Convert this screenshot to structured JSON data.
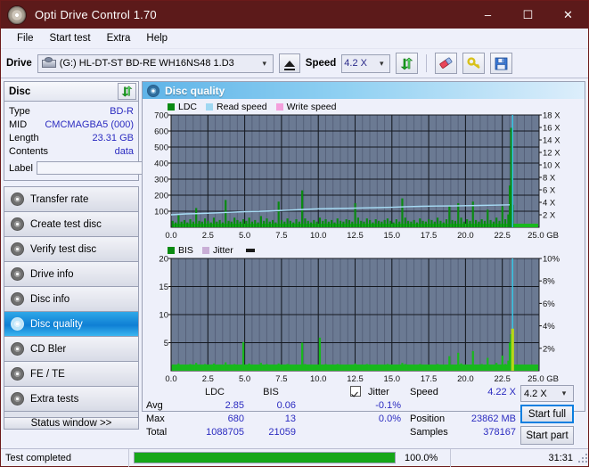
{
  "window": {
    "title": "Opti Drive Control 1.70",
    "icon": "disc-icon",
    "minimize": "–",
    "maximize": "☐",
    "close": "✕"
  },
  "menu": {
    "items": [
      "File",
      "Start test",
      "Extra",
      "Help"
    ]
  },
  "toolbar": {
    "drive_label": "Drive",
    "drive_value": "(G:)  HL-DT-ST BD-RE  WH16NS48 1.D3",
    "eject_icon": "eject-icon",
    "speed_label": "Speed",
    "speed_value": "4.2 X",
    "refresh_icon": "refresh-icon",
    "erase_icon": "eraser-icon",
    "key_icon": "key-icon",
    "save_icon": "save-icon"
  },
  "disc": {
    "title": "Disc",
    "refresh_icon": "refresh-icon",
    "rows": [
      {
        "label": "Type",
        "value": "BD-R"
      },
      {
        "label": "MID",
        "value": "CMCMAGBA5 (000)"
      },
      {
        "label": "Length",
        "value": "23.31 GB"
      },
      {
        "label": "Contents",
        "value": "data"
      }
    ],
    "label_field": {
      "label": "Label",
      "value": "",
      "placeholder": ""
    },
    "label_button_icon": "disc-label-icon"
  },
  "nav": {
    "items": [
      {
        "label": "Transfer rate",
        "icon": "disc-transfer-icon",
        "active": false
      },
      {
        "label": "Create test disc",
        "icon": "disc-create-icon",
        "active": false
      },
      {
        "label": "Verify test disc",
        "icon": "disc-verify-icon",
        "active": false
      },
      {
        "label": "Drive info",
        "icon": "disc-drive-icon",
        "active": false
      },
      {
        "label": "Disc info",
        "icon": "disc-info-icon",
        "active": false
      },
      {
        "label": "Disc quality",
        "icon": "disc-quality-icon",
        "active": true
      },
      {
        "label": "CD Bler",
        "icon": "disc-bler-icon",
        "active": false
      },
      {
        "label": "FE / TE",
        "icon": "disc-fete-icon",
        "active": false
      },
      {
        "label": "Extra tests",
        "icon": "disc-extra-icon",
        "active": false
      }
    ],
    "status_window_button": "Status window >>"
  },
  "main": {
    "header_title": "Disc quality",
    "header_icon": "disc-quality-icon"
  },
  "chart_data": [
    {
      "type": "line",
      "name": "ldc-chart",
      "title": "",
      "xlabel": "GB",
      "ylabel": "",
      "xlim": [
        0,
        25.0
      ],
      "ylim": [
        0,
        700
      ],
      "y2lim": [
        0,
        18
      ],
      "grid": true,
      "legend_position": "top-left",
      "legend": [
        {
          "label": "LDC",
          "color": "#0a8a12"
        },
        {
          "label": "Read speed",
          "color": "#9fd8f2"
        },
        {
          "label": "Write speed",
          "color": "#f49fdc"
        }
      ],
      "xticks": [
        "0.0",
        "2.5",
        "5.0",
        "7.5",
        "10.0",
        "12.5",
        "15.0",
        "17.5",
        "20.0",
        "22.5",
        "25.0 GB"
      ],
      "yticks": [
        "100",
        "200",
        "300",
        "400",
        "500",
        "600",
        "700"
      ],
      "y2ticks": [
        "2 X",
        "4 X",
        "6 X",
        "8 X",
        "10 X",
        "12 X",
        "14 X",
        "16 X",
        "18 X"
      ],
      "series": [
        {
          "name": "LDC",
          "color": "#0a8a12",
          "style": "bars",
          "x": [
            0.1,
            0.3,
            0.5,
            0.7,
            0.9,
            1.1,
            1.3,
            1.5,
            1.7,
            1.9,
            2.1,
            2.3,
            2.5,
            2.7,
            2.9,
            3.1,
            3.3,
            3.5,
            3.7,
            3.9,
            4.1,
            4.3,
            4.5,
            4.7,
            4.9,
            5.1,
            5.3,
            5.5,
            5.7,
            5.9,
            6.1,
            6.3,
            6.5,
            6.7,
            6.9,
            7.1,
            7.3,
            7.5,
            7.7,
            7.9,
            8.1,
            8.3,
            8.5,
            8.7,
            8.9,
            9.1,
            9.3,
            9.5,
            9.7,
            9.9,
            10.1,
            10.3,
            10.5,
            10.7,
            10.9,
            11.1,
            11.3,
            11.5,
            11.7,
            11.9,
            12.1,
            12.3,
            12.5,
            12.7,
            12.9,
            13.1,
            13.3,
            13.5,
            13.7,
            13.9,
            14.1,
            14.3,
            14.5,
            14.7,
            14.9,
            15.1,
            15.3,
            15.5,
            15.7,
            15.9,
            16.1,
            16.3,
            16.5,
            16.7,
            16.9,
            17.1,
            17.3,
            17.5,
            17.7,
            17.9,
            18.1,
            18.3,
            18.5,
            18.7,
            18.9,
            19.1,
            19.3,
            19.5,
            19.7,
            19.9,
            20.1,
            20.3,
            20.5,
            20.7,
            20.9,
            21.1,
            21.3,
            21.5,
            21.7,
            21.9,
            22.1,
            22.3,
            22.5,
            22.7,
            22.9,
            23.0,
            23.1,
            23.2
          ],
          "values": [
            40,
            30,
            75,
            35,
            45,
            30,
            50,
            35,
            120,
            40,
            35,
            55,
            40,
            30,
            60,
            35,
            45,
            30,
            170,
            40,
            35,
            60,
            45,
            35,
            50,
            40,
            60,
            35,
            45,
            30,
            70,
            40,
            55,
            35,
            45,
            30,
            160,
            45,
            35,
            55,
            40,
            30,
            50,
            35,
            230,
            55,
            40,
            30,
            45,
            35,
            60,
            40,
            50,
            35,
            45,
            30,
            55,
            40,
            35,
            50,
            45,
            35,
            150,
            60,
            40,
            35,
            55,
            45,
            30,
            50,
            40,
            35,
            45,
            55,
            40,
            30,
            50,
            35,
            180,
            60,
            40,
            35,
            45,
            30,
            55,
            40,
            35,
            50,
            45,
            35,
            60,
            40,
            30,
            50,
            130,
            45,
            40,
            150,
            60,
            35,
            50,
            40,
            160,
            45,
            35,
            50,
            40,
            110,
            45,
            35,
            60,
            40,
            130,
            50,
            80,
            260,
            620,
            140
          ]
        },
        {
          "name": "Read speed",
          "color": "#a7dcf5",
          "style": "line",
          "x": [
            0.0,
            1.0,
            2.0,
            3.0,
            4.0,
            5.0,
            6.0,
            7.0,
            8.0,
            9.0,
            10.0,
            11.0,
            12.0,
            13.0,
            14.0,
            15.0,
            16.0,
            17.0,
            18.0,
            19.0,
            20.0,
            21.0,
            22.0,
            23.0
          ],
          "values": [
            2.0,
            2.15,
            2.2,
            2.3,
            2.4,
            2.5,
            2.55,
            2.65,
            2.75,
            2.85,
            2.95,
            3.0,
            3.05,
            3.1,
            3.15,
            3.2,
            3.3,
            3.35,
            3.4,
            3.42,
            3.45,
            3.5,
            3.55,
            3.6
          ]
        },
        {
          "name": "Write speed",
          "color": "#f49fdc",
          "style": "line",
          "x": [],
          "values": []
        }
      ],
      "markers": [
        {
          "name": "end-of-disc-marker",
          "x": 23.2,
          "color": "#35c8e8"
        }
      ]
    },
    {
      "type": "line",
      "name": "bis-chart",
      "title": "",
      "xlabel": "GB",
      "ylabel": "",
      "xlim": [
        0,
        25.0
      ],
      "ylim": [
        0,
        20
      ],
      "y2lim": [
        0,
        10
      ],
      "grid": true,
      "legend_position": "top-left",
      "legend": [
        {
          "label": "BIS",
          "color": "#0a8a12"
        },
        {
          "label": "Jitter",
          "color": "#c9aed6"
        }
      ],
      "xticks": [
        "0.0",
        "2.5",
        "5.0",
        "7.5",
        "10.0",
        "12.5",
        "15.0",
        "17.5",
        "20.0",
        "22.5",
        "25.0 GB"
      ],
      "yticks": [
        "5",
        "10",
        "15",
        "20"
      ],
      "y2ticks": [
        "2%",
        "4%",
        "6%",
        "8%",
        "10%"
      ],
      "series": [
        {
          "name": "BIS",
          "color": "#18b81c",
          "style": "bars",
          "x": [
            0.1,
            0.3,
            0.5,
            0.7,
            0.9,
            1.1,
            1.3,
            1.5,
            1.7,
            1.9,
            2.1,
            2.3,
            2.5,
            2.7,
            2.9,
            3.1,
            3.3,
            3.5,
            3.7,
            3.9,
            4.1,
            4.3,
            4.5,
            4.7,
            4.9,
            5.1,
            5.3,
            5.5,
            5.7,
            5.9,
            6.1,
            6.3,
            6.5,
            6.7,
            6.9,
            7.1,
            7.3,
            7.5,
            7.7,
            7.9,
            8.1,
            8.3,
            8.5,
            8.7,
            8.9,
            9.1,
            9.3,
            9.5,
            9.7,
            9.9,
            10.1,
            10.3,
            10.5,
            10.7,
            10.9,
            11.1,
            11.3,
            11.5,
            11.7,
            11.9,
            12.1,
            12.3,
            12.5,
            12.7,
            12.9,
            13.1,
            13.3,
            13.5,
            13.7,
            13.9,
            14.1,
            14.3,
            14.5,
            14.7,
            14.9,
            15.1,
            15.3,
            15.5,
            15.7,
            15.9,
            16.1,
            16.3,
            16.5,
            16.7,
            16.9,
            17.1,
            17.3,
            17.5,
            17.7,
            17.9,
            18.1,
            18.3,
            18.5,
            18.7,
            18.9,
            19.1,
            19.3,
            19.5,
            19.7,
            19.9,
            20.1,
            20.3,
            20.5,
            20.7,
            20.9,
            21.1,
            21.3,
            21.5,
            21.7,
            21.9,
            22.1,
            22.3,
            22.5,
            22.7,
            22.9,
            23.0,
            23.1,
            23.2
          ],
          "values": [
            1.0,
            0.8,
            1.3,
            0.9,
            1.1,
            0.8,
            1.2,
            0.9,
            1.4,
            1.0,
            0.8,
            1.2,
            1.0,
            0.8,
            1.3,
            0.9,
            1.1,
            0.8,
            1.5,
            1.0,
            0.9,
            1.2,
            1.0,
            0.9,
            5.1,
            1.1,
            1.3,
            0.9,
            1.1,
            0.8,
            1.4,
            1.0,
            1.2,
            0.9,
            1.1,
            0.8,
            1.3,
            1.0,
            0.9,
            1.2,
            1.0,
            0.8,
            1.1,
            0.9,
            5.0,
            1.2,
            1.0,
            0.8,
            1.1,
            0.9,
            5.9,
            1.1,
            1.2,
            0.9,
            1.1,
            0.8,
            1.2,
            1.0,
            0.9,
            1.1,
            1.0,
            0.9,
            1.3,
            1.1,
            1.0,
            0.9,
            1.2,
            1.0,
            0.8,
            1.1,
            0.9,
            0.8,
            1.0,
            1.2,
            0.9,
            0.8,
            1.1,
            0.9,
            1.4,
            1.2,
            1.0,
            0.9,
            1.1,
            0.8,
            1.2,
            1.0,
            0.9,
            1.1,
            1.0,
            0.9,
            1.2,
            1.0,
            0.8,
            1.1,
            2.6,
            1.0,
            0.9,
            3.2,
            1.3,
            0.9,
            1.1,
            1.0,
            3.5,
            1.1,
            0.9,
            1.2,
            1.0,
            2.3,
            1.1,
            0.9,
            1.4,
            1.0,
            2.7,
            1.2,
            1.8,
            5.0,
            6.5,
            3.0
          ]
        },
        {
          "name": "Jitter",
          "color": "#c9aed6",
          "style": "line",
          "x": [],
          "values": []
        }
      ],
      "markers": [
        {
          "name": "end-of-disc-marker",
          "x": 23.2,
          "color": "#35c8e8"
        }
      ]
    }
  ],
  "stats": {
    "col_headers": [
      "",
      "LDC",
      "BIS"
    ],
    "rows": [
      {
        "label": "Avg",
        "ldc": "2.85",
        "bis": "0.06",
        "jitter": "-0.1%"
      },
      {
        "label": "Max",
        "ldc": "680",
        "bis": "13",
        "jitter": "0.0%"
      },
      {
        "label": "Total",
        "ldc": "1088705",
        "bis": "21059",
        "jitter": ""
      }
    ],
    "jitter_label": "Jitter",
    "jitter_checked": true,
    "right": [
      {
        "label": "Speed",
        "value": "4.22 X"
      },
      {
        "label": "Position",
        "value": "23862 MB"
      },
      {
        "label": "Samples",
        "value": "378167"
      }
    ],
    "speed_select": "4.2 X",
    "start_full_button": "Start full",
    "start_part_button": "Start part"
  },
  "statusbar": {
    "message": "Test completed",
    "progress_percent": 100.0,
    "progress_text": "100.0%",
    "elapsed": "31:31"
  },
  "colors": {
    "titlebar": "#5c1a1a",
    "accent": "#0a7fe0",
    "ldc_green": "#0a8a12",
    "read_speed": "#a7dcf5",
    "write_speed": "#f49fdc",
    "jitter": "#c9aed6",
    "plot_bg": "#6b7a93",
    "value_blue": "#2b2bc0",
    "progress_green": "#17a71a"
  }
}
